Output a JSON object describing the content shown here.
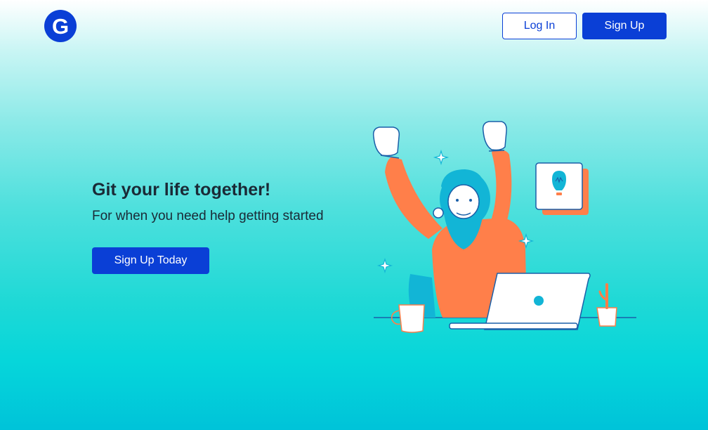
{
  "header": {
    "logo_letter": "G",
    "login_label": "Log In",
    "signup_label": "Sign Up"
  },
  "hero": {
    "title": "Git your life together!",
    "subtitle": "For when you need help getting started",
    "cta_label": "Sign Up Today"
  },
  "colors": {
    "brand_blue": "#0a3fd6",
    "accent_orange": "#ff7f4a",
    "accent_cyan": "#12b5d6",
    "text_dark": "#1a2a36"
  }
}
